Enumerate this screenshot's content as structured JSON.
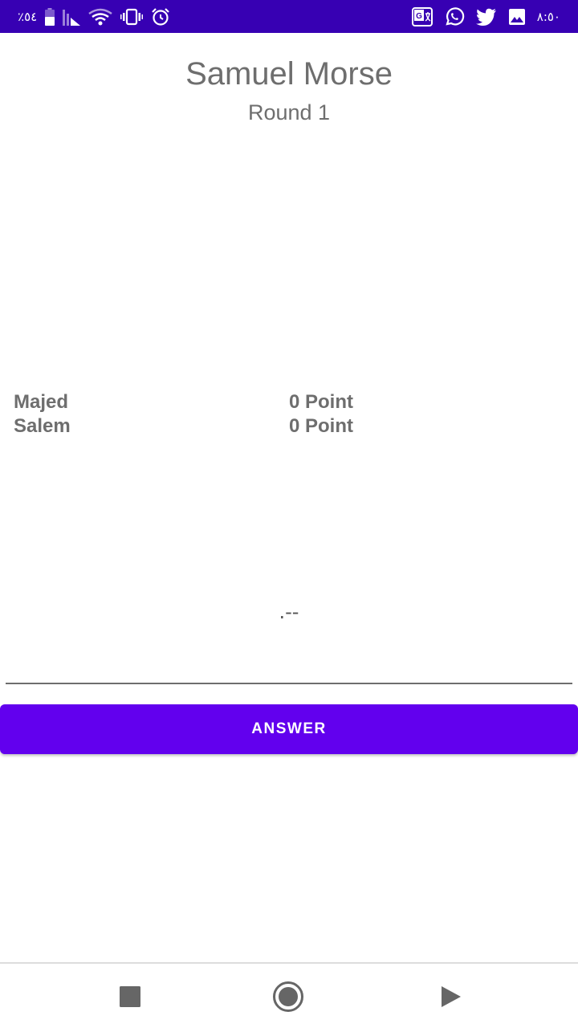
{
  "status_bar": {
    "battery_percent_text": "٪٥٤",
    "time": "٨:٥٠",
    "icons_left": [
      "battery-icon",
      "signal-icon",
      "wifi-icon",
      "vibrate-icon",
      "alarm-icon"
    ],
    "icons_right": [
      "translate-icon",
      "whatsapp-icon",
      "twitter-icon",
      "image-icon"
    ],
    "color": "#3700b3"
  },
  "header": {
    "title": "Samuel Morse",
    "subtitle": "Round 1"
  },
  "players": [
    {
      "name": "Majed",
      "score": "0 Point"
    },
    {
      "name": "Salem",
      "score": "0 Point"
    }
  ],
  "morse_code": ".--",
  "answer_input": {
    "value": "",
    "placeholder": ""
  },
  "answer_button": {
    "label": "ANSWER",
    "color": "#6200ee"
  },
  "nav_bar": {
    "icons": [
      "square-stop-icon",
      "circle-record-icon",
      "triangle-play-icon"
    ]
  }
}
